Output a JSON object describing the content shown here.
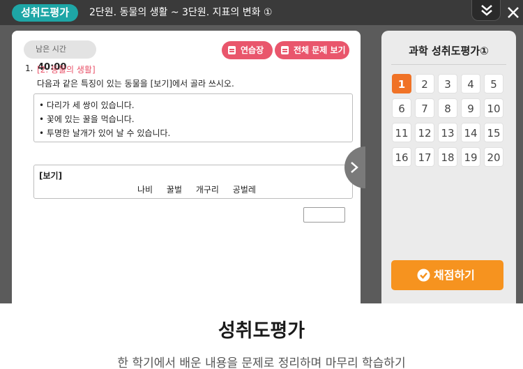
{
  "header": {
    "badge": "성취도평가",
    "unit_title": "2단원. 동물의 생활 ~ 3단원. 지표의 변화 ①"
  },
  "timer": {
    "label": "남은 시간",
    "value": "40:00"
  },
  "toolbar": {
    "practice_label": "연습장",
    "all_questions_label": "전체 문제 보기"
  },
  "question": {
    "number": "1.",
    "tag": "[2. 동물의 생활]",
    "text": "다음과 같은 특징이 있는 동물을 [보기]에서 골라 쓰시오.",
    "hints": [
      "• 다리가 세 쌍이 있습니다.",
      "• 꽃에 있는 꿀을 먹습니다.",
      "• 투명한 날개가 있어 날 수 있습니다."
    ],
    "example_title": "[보기]",
    "example_items": [
      "나비",
      "꿀벌",
      "개구리",
      "공벌레"
    ],
    "answer_value": ""
  },
  "side_panel": {
    "title": "과학 성취도평가①",
    "questions": [
      "1",
      "2",
      "3",
      "4",
      "5",
      "6",
      "7",
      "8",
      "9",
      "10",
      "11",
      "12",
      "13",
      "14",
      "15",
      "16",
      "17",
      "18",
      "19",
      "20"
    ],
    "active_question": "1",
    "grade_label": "채점하기"
  },
  "caption": {
    "title": "성취도평가",
    "subtitle": "한 학기에서 배운 내용을 문제로 정리하며 마무리 학습하기"
  },
  "colors": {
    "accent_teal": "#1ea6a6",
    "accent_pink": "#e9566c",
    "accent_orange": "#f07226",
    "grade_orange": "#f6931f"
  }
}
